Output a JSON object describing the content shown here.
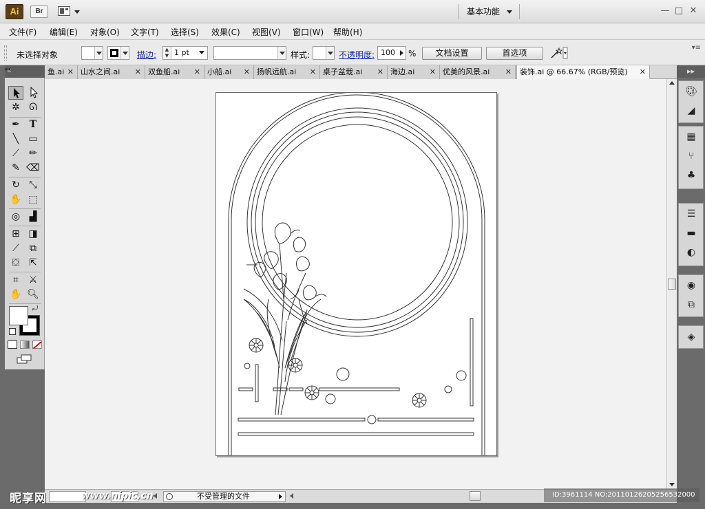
{
  "titlebar": {
    "app_logo": "Ai",
    "bridge": "Br",
    "workspace": "基本功能",
    "win_min": "—",
    "win_max": "□",
    "win_close": "✕"
  },
  "menu": [
    "文件(F)",
    "编辑(E)",
    "对象(O)",
    "文字(T)",
    "选择(S)",
    "效果(C)",
    "视图(V)",
    "窗口(W)",
    "帮助(H)"
  ],
  "control": {
    "selection": "未选择对象",
    "stroke_label": "描边:",
    "stroke_weight": "1 pt",
    "style_label": "样式:",
    "opacity_label": "不透明度:",
    "opacity_value": "100",
    "opacity_unit": "%",
    "doc_setup": "文档设置",
    "preferences": "首选项"
  },
  "tabs": [
    {
      "label": "鱼.ai"
    },
    {
      "label": "山水之间.ai"
    },
    {
      "label": "双鱼船.ai"
    },
    {
      "label": "小船.ai"
    },
    {
      "label": "扬帆远航.ai"
    },
    {
      "label": "桌子盆栽.ai"
    },
    {
      "label": "海边.ai"
    },
    {
      "label": "优美的风景.ai"
    },
    {
      "label": "装饰.ai @ 66.67% (RGB/预览)",
      "active": true
    }
  ],
  "tab_close": "✕",
  "tab_overflow": ">>",
  "tab_collapse": "◂◂",
  "status": {
    "file_status": "不受管理的文件"
  },
  "watermark": {
    "logo": "昵享网",
    "url": "www.nipic.cn",
    "id": "ID:3961114 NO:20110126205256532000"
  },
  "colors": {
    "accent_link": "#1a2ea8",
    "app_logo_bg": "#5a3f1a",
    "app_logo_fg": "#f8c640",
    "dock": "#6b6b6b",
    "canvas": "#f2f2f2"
  }
}
